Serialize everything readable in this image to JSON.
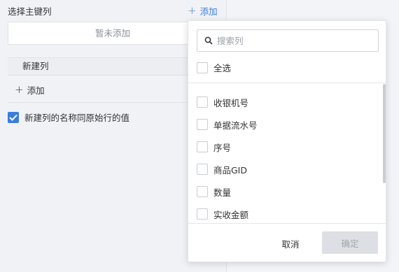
{
  "primary_key": {
    "title": "选择主键列",
    "add_label": "添加",
    "empty_text": "暂未添加"
  },
  "new_columns": {
    "header": "新建列",
    "add_label": "添加"
  },
  "options": {
    "same_name_label": "新建列的名称同原始行的值",
    "same_name_checked": true
  },
  "dropdown": {
    "search_placeholder": "搜索列",
    "select_all_label": "全选",
    "items": [
      {
        "label": "收银机号",
        "checked": false
      },
      {
        "label": "单据流水号",
        "checked": false
      },
      {
        "label": "序号",
        "checked": false
      },
      {
        "label": "商品GID",
        "checked": false
      },
      {
        "label": "数量",
        "checked": false
      },
      {
        "label": "实收金额",
        "checked": false
      }
    ],
    "cancel_label": "取消",
    "confirm_label": "确定"
  },
  "colors": {
    "accent": "#3b7ddd",
    "disabled_button": "#dddfe4"
  }
}
